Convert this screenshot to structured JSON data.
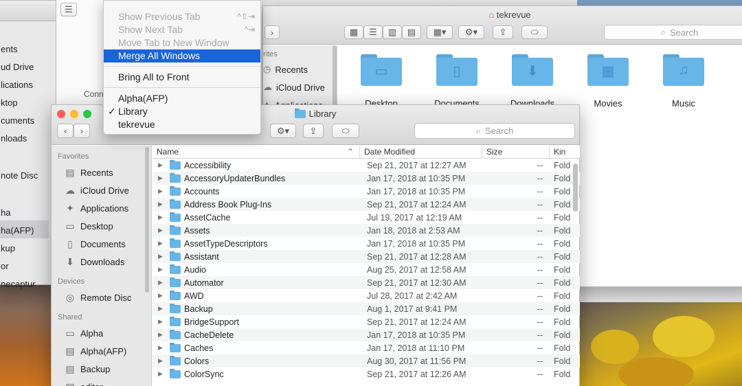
{
  "back_window": {
    "title": "tekrevue",
    "search_placeholder": "Search",
    "sidebar_heading": "rites",
    "sidebar": [
      "Recents",
      "iCloud Drive",
      "Applications"
    ],
    "folders": [
      {
        "label": "Desktop",
        "icon": "window-icon"
      },
      {
        "label": "Documents",
        "icon": "document-icon"
      },
      {
        "label": "Downloads",
        "icon": "download-icon"
      },
      {
        "label": "Movies",
        "icon": "film-icon"
      },
      {
        "label": "Music",
        "icon": "music-note-icon"
      }
    ]
  },
  "left_window": {
    "items": [
      "ents",
      "ud Drive",
      "lications",
      "ktop",
      "cuments",
      "nloads",
      "note Disc",
      "ha",
      "ha(AFP)",
      "kup",
      "or",
      "necaptur"
    ],
    "partial_label": "Conn"
  },
  "window_menu": {
    "items": [
      {
        "label": "Show Previous Tab",
        "shortcut": "^⇧⇥",
        "disabled": true
      },
      {
        "label": "Show Next Tab",
        "shortcut": "^⇥",
        "disabled": true
      },
      {
        "label": "Move Tab to New Window",
        "shortcut": "",
        "disabled": true
      },
      {
        "label": "Merge All Windows",
        "shortcut": "",
        "active": true
      },
      {
        "label": "Bring All to Front",
        "shortcut": ""
      },
      {
        "label": "Alpha(AFP)",
        "shortcut": ""
      },
      {
        "label": "Library",
        "shortcut": "",
        "checked": true
      },
      {
        "label": "tekrevue",
        "shortcut": ""
      }
    ],
    "check_mark": "✓"
  },
  "library_window": {
    "title": "Library",
    "search_placeholder": "Search",
    "sidebar": {
      "favorites_heading": "Favorites",
      "favorites": [
        {
          "label": "Recents",
          "icon": "clock-icon"
        },
        {
          "label": "iCloud Drive",
          "icon": "cloud-icon"
        },
        {
          "label": "Applications",
          "icon": "applications-icon"
        },
        {
          "label": "Desktop",
          "icon": "desktop-icon"
        },
        {
          "label": "Documents",
          "icon": "documents-icon"
        },
        {
          "label": "Downloads",
          "icon": "downloads-icon"
        }
      ],
      "devices_heading": "Devices",
      "devices": [
        {
          "label": "Remote Disc",
          "icon": "disc-icon"
        }
      ],
      "shared_heading": "Shared",
      "shared": [
        {
          "label": "Alpha",
          "icon": "monitor-icon"
        },
        {
          "label": "Alpha(AFP)",
          "icon": "server-icon"
        },
        {
          "label": "Backup",
          "icon": "server-icon"
        },
        {
          "label": "editor",
          "icon": "server-icon"
        }
      ]
    },
    "columns": {
      "name": "Name",
      "date": "Date Modified",
      "size": "Size",
      "kind": "Kin"
    },
    "rows": [
      {
        "name": "Accessibility",
        "date": "Sep 21, 2017 at 12:27 AM",
        "size": "--",
        "kind": "Fold"
      },
      {
        "name": "AccessoryUpdaterBundles",
        "date": "Jan 17, 2018 at 10:35 PM",
        "size": "--",
        "kind": "Fold"
      },
      {
        "name": "Accounts",
        "date": "Jan 17, 2018 at 10:35 PM",
        "size": "--",
        "kind": "Fold"
      },
      {
        "name": "Address Book Plug-Ins",
        "date": "Sep 21, 2017 at 12:24 AM",
        "size": "--",
        "kind": "Fold"
      },
      {
        "name": "AssetCache",
        "date": "Jul 19, 2017 at 12:19 AM",
        "size": "--",
        "kind": "Fold"
      },
      {
        "name": "Assets",
        "date": "Jan 18, 2018 at 2:53 AM",
        "size": "--",
        "kind": "Fold"
      },
      {
        "name": "AssetTypeDescriptors",
        "date": "Jan 17, 2018 at 10:35 PM",
        "size": "--",
        "kind": "Fold"
      },
      {
        "name": "Assistant",
        "date": "Sep 21, 2017 at 12:28 AM",
        "size": "--",
        "kind": "Fold"
      },
      {
        "name": "Audio",
        "date": "Aug 25, 2017 at 12:58 AM",
        "size": "--",
        "kind": "Fold"
      },
      {
        "name": "Automator",
        "date": "Sep 21, 2017 at 12:30 AM",
        "size": "--",
        "kind": "Fold"
      },
      {
        "name": "AWD",
        "date": "Jul 28, 2017 at 2:42 AM",
        "size": "--",
        "kind": "Fold"
      },
      {
        "name": "Backup",
        "date": "Aug 1, 2017 at 9:41 PM",
        "size": "--",
        "kind": "Fold"
      },
      {
        "name": "BridgeSupport",
        "date": "Sep 21, 2017 at 12:24 AM",
        "size": "--",
        "kind": "Fold"
      },
      {
        "name": "CacheDelete",
        "date": "Jan 17, 2018 at 10:35 PM",
        "size": "--",
        "kind": "Fold"
      },
      {
        "name": "Caches",
        "date": "Jan 17, 2018 at 11:10 PM",
        "size": "--",
        "kind": "Fold"
      },
      {
        "name": "Colors",
        "date": "Aug 30, 2017 at 11:56 PM",
        "size": "--",
        "kind": "Fold"
      },
      {
        "name": "ColorSync",
        "date": "Sep 21, 2017 at 12:26 AM",
        "size": "--",
        "kind": "Fold"
      }
    ]
  },
  "colors": {
    "accent": "#1a64d9",
    "folder": "#68b5e8",
    "close": "#fc5f57",
    "minimize": "#fdbc2e",
    "zoom": "#28c840"
  }
}
